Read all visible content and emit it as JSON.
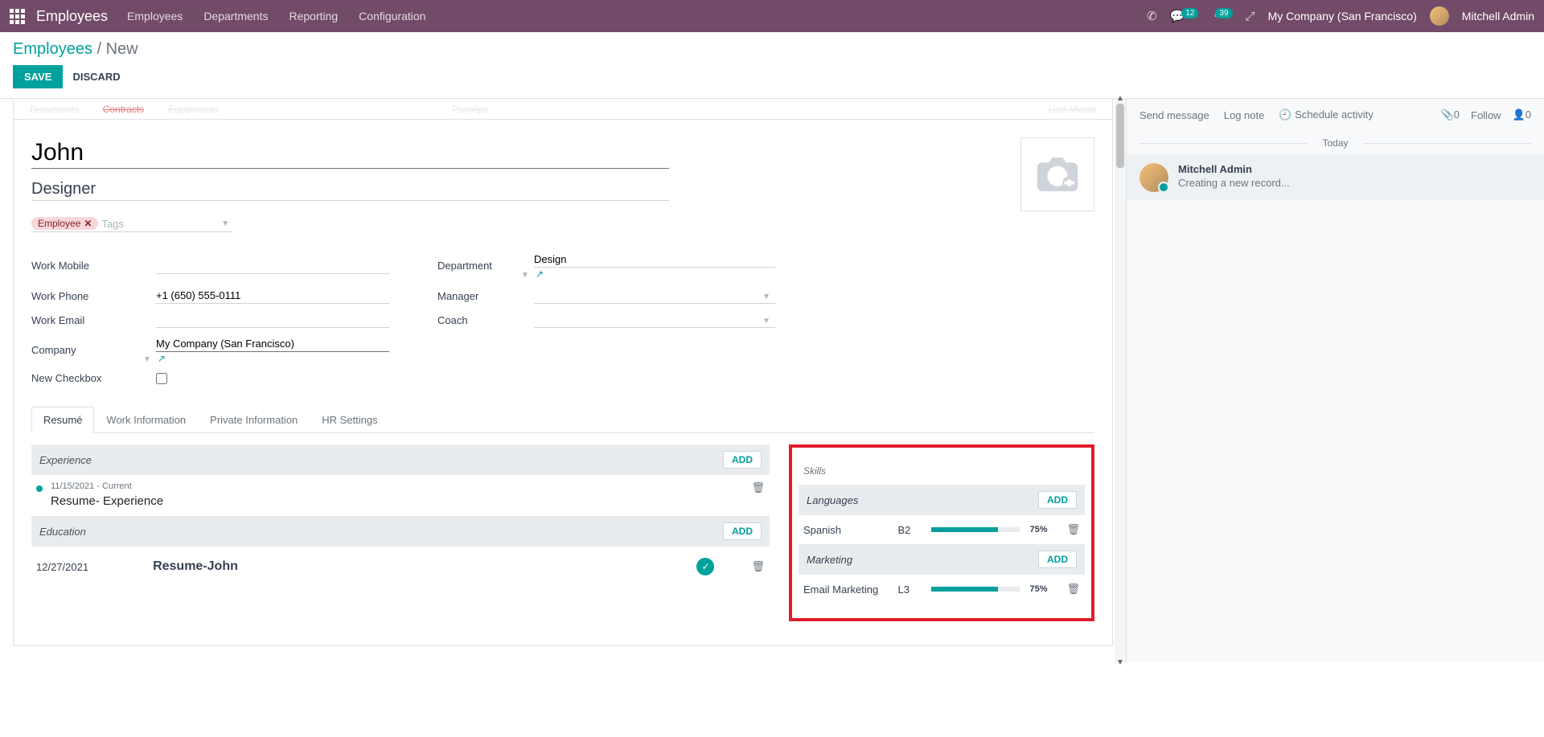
{
  "topnav": {
    "brand": "Employees",
    "menu": [
      "Employees",
      "Departments",
      "Reporting",
      "Configuration"
    ],
    "chat_badge": "12",
    "clock_badge": "39",
    "company": "My Company (San Francisco)",
    "user": "Mitchell Admin"
  },
  "breadcrumb": {
    "root": "Employees",
    "current": "New"
  },
  "actions": {
    "save": "SAVE",
    "discard": "DISCARD"
  },
  "statbar": {
    "documents": "Documents",
    "contracts": "Contracts",
    "equipments": "Equipments",
    "payslips": "Payslips",
    "lastmonth": "Last Month"
  },
  "form": {
    "name": "John",
    "job_title": "Designer",
    "tag": "Employee",
    "tags_placeholder": "Tags",
    "labels": {
      "work_mobile": "Work Mobile",
      "work_phone": "Work Phone",
      "work_email": "Work Email",
      "company": "Company",
      "new_checkbox": "New Checkbox",
      "department": "Department",
      "manager": "Manager",
      "coach": "Coach"
    },
    "values": {
      "work_mobile": "",
      "work_phone": "+1 (650) 555-0111",
      "work_email": "",
      "company": "My Company (San Francisco)",
      "department": "Design",
      "manager": "",
      "coach": ""
    }
  },
  "tabs": [
    "Resumé",
    "Work Information",
    "Private Information",
    "HR Settings"
  ],
  "resume": {
    "experience_title": "Experience",
    "add_label": "ADD",
    "exp_item": {
      "dates": "11/15/2021 - Current",
      "title": "Resume- Experience"
    },
    "education_title": "Education",
    "edu_item": {
      "date": "12/27/2021",
      "file": "Resume-John"
    }
  },
  "skills": {
    "section_title": "Skills",
    "add_label": "ADD",
    "groups": [
      {
        "name": "Languages",
        "items": [
          {
            "name": "Spanish",
            "level": "B2",
            "pct": "75%",
            "fill": 75
          }
        ]
      },
      {
        "name": "Marketing",
        "items": [
          {
            "name": "Email Marketing",
            "level": "L3",
            "pct": "75%",
            "fill": 75
          }
        ]
      }
    ]
  },
  "chatter": {
    "send": "Send message",
    "log": "Log note",
    "schedule": "Schedule activity",
    "attach_count": "0",
    "follow": "Follow",
    "follower_count": "0",
    "today": "Today",
    "msg_author": "Mitchell Admin",
    "msg_body": "Creating a new record..."
  }
}
